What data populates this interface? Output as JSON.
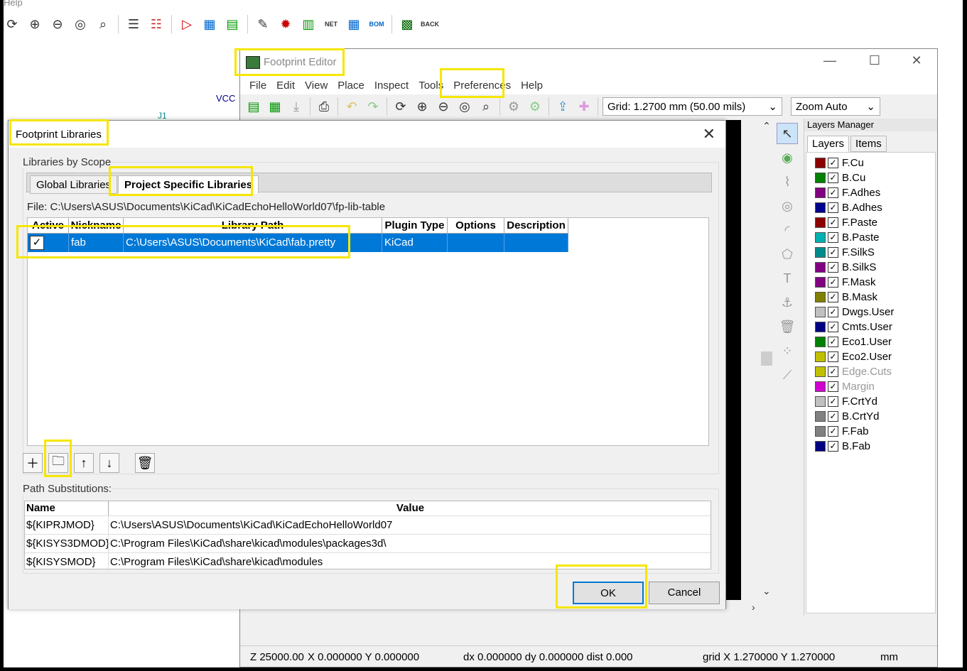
{
  "background": {
    "menu_label": "Help",
    "vcc_label": "VCC",
    "j1_label": "J1",
    "toolbar_icons": [
      "rotate-icon",
      "zoom-in-icon",
      "zoom-out-icon",
      "zoom-fit-icon",
      "zoom-selection-icon",
      "netlist-icon",
      "annotate-icon",
      "erc-icon",
      "sim-icon",
      "footprint-assign-icon",
      "edit-symbol-icon",
      "bug-icon",
      "bus-icon",
      "net-icon",
      "grid-table-icon",
      "bom-icon",
      "pcb-icon",
      "back-icon"
    ],
    "back_label": "BACK",
    "net_label": "NET",
    "bom_label": "BOM"
  },
  "footprint_editor": {
    "title": "Footprint Editor",
    "menu": [
      "File",
      "Edit",
      "View",
      "Place",
      "Inspect",
      "Tools",
      "Preferences",
      "Help"
    ],
    "grid_select": "Grid: 1.2700 mm (50.00 mils)",
    "zoom_select": "Zoom Auto",
    "layers_manager": {
      "title": "Layers Manager",
      "tabs": [
        "Layers",
        "Items"
      ],
      "layers": [
        {
          "name": "F.Cu",
          "color": "#8b0000",
          "checked": true
        },
        {
          "name": "B.Cu",
          "color": "#008000",
          "checked": true
        },
        {
          "name": "F.Adhes",
          "color": "#800080",
          "checked": true
        },
        {
          "name": "B.Adhes",
          "color": "#00008b",
          "checked": true
        },
        {
          "name": "F.Paste",
          "color": "#8b0000",
          "checked": true
        },
        {
          "name": "B.Paste",
          "color": "#00b0b0",
          "checked": true
        },
        {
          "name": "F.SilkS",
          "color": "#008b8b",
          "checked": true
        },
        {
          "name": "B.SilkS",
          "color": "#800080",
          "checked": true
        },
        {
          "name": "F.Mask",
          "color": "#800080",
          "checked": true
        },
        {
          "name": "B.Mask",
          "color": "#808000",
          "checked": true
        },
        {
          "name": "Dwgs.User",
          "color": "#c0c0c0",
          "checked": true
        },
        {
          "name": "Cmts.User",
          "color": "#000080",
          "checked": true
        },
        {
          "name": "Eco1.User",
          "color": "#008000",
          "checked": true
        },
        {
          "name": "Eco2.User",
          "color": "#c0c000",
          "checked": true
        },
        {
          "name": "Edge.Cuts",
          "color": "#c0c000",
          "checked": true,
          "dim": true
        },
        {
          "name": "Margin",
          "color": "#d000d0",
          "checked": true,
          "dim": true
        },
        {
          "name": "F.CrtYd",
          "color": "#c0c0c0",
          "checked": true
        },
        {
          "name": "B.CrtYd",
          "color": "#808080",
          "checked": true
        },
        {
          "name": "F.Fab",
          "color": "#808080",
          "checked": true
        },
        {
          "name": "B.Fab",
          "color": "#000080",
          "checked": true
        }
      ]
    },
    "status": {
      "z": "Z 25000.00",
      "xy": "X 0.000000  Y 0.000000",
      "d": "dx 0.000000  dy 0.000000  dist 0.000",
      "grid": "grid X 1.270000  Y 1.270000",
      "units": "mm"
    }
  },
  "dialog": {
    "title": "Footprint Libraries",
    "scope_label": "Libraries by Scope",
    "tabs": [
      "Global Libraries",
      "Project Specific Libraries"
    ],
    "file_line": "File:  C:\\Users\\ASUS\\Documents\\KiCad\\KiCadEchoHelloWorld07\\fp-lib-table",
    "columns": [
      "Active",
      "Nickname",
      "Library Path",
      "Plugin Type",
      "Options",
      "Description"
    ],
    "rows": [
      {
        "nickname": "fab",
        "path": "C:\\Users\\ASUS\\Documents\\KiCad\\fab.pretty",
        "plugin": "KiCad",
        "options": "",
        "description": ""
      }
    ],
    "path_label": "Path Substitutions:",
    "path_columns": [
      "Name",
      "Value"
    ],
    "paths": [
      {
        "name": "${KIPRJMOD}",
        "value": "C:\\Users\\ASUS\\Documents\\KiCad\\KiCadEchoHelloWorld07"
      },
      {
        "name": "${KISYS3DMOD}",
        "value": "C:\\Program Files\\KiCad\\share\\kicad\\modules\\packages3d\\"
      },
      {
        "name": "${KISYSMOD}",
        "value": "C:\\Program Files\\KiCad\\share\\kicad\\modules"
      }
    ],
    "ok": "OK",
    "cancel": "Cancel"
  }
}
